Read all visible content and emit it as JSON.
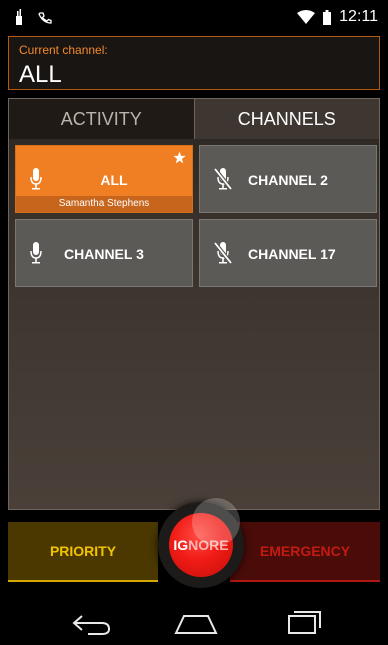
{
  "status_bar": {
    "time": "12:11",
    "icons": [
      "usb-icon",
      "voicemail-icon",
      "wifi-icon",
      "battery-icon"
    ]
  },
  "current_channel": {
    "label": "Current channel:",
    "value": "ALL"
  },
  "tabs": [
    {
      "label": "ACTIVITY",
      "active": false
    },
    {
      "label": "CHANNELS",
      "active": true
    }
  ],
  "channels": [
    {
      "name": "ALL",
      "subtitle": "Samantha Stephens",
      "selected": true,
      "favorite": true,
      "mic": "on"
    },
    {
      "name": "CHANNEL 2",
      "selected": false,
      "mic": "off"
    },
    {
      "name": "CHANNEL 3",
      "selected": false,
      "mic": "on"
    },
    {
      "name": "CHANNEL 17",
      "selected": false,
      "mic": "off"
    }
  ],
  "actions": {
    "priority_label": "PRIORITY",
    "ignore_label_part1": "IG",
    "ignore_label_part2": "NORE",
    "emergency_label": "EMERGENCY"
  },
  "colors": {
    "accent_orange": "#ef7f22",
    "priority_yellow": "#f2c300",
    "emergency_red": "#c31b12",
    "ignore_red": "#f11c16"
  }
}
